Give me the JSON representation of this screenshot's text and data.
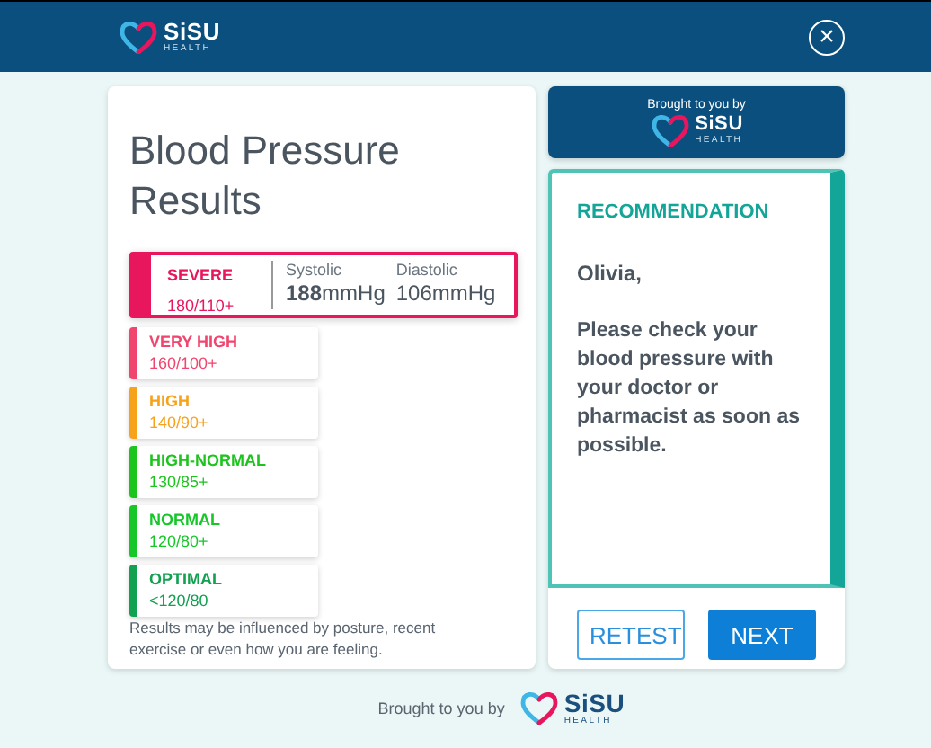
{
  "header": {
    "logo": {
      "name": "SiSU",
      "tagline": "HEALTH"
    },
    "close_label": "×"
  },
  "results": {
    "title": "Blood Pressure Results",
    "categories": [
      {
        "label": "SEVERE",
        "range": "180/110+",
        "color": "#e8175d",
        "selected": true
      },
      {
        "label": "VERY HIGH",
        "range": "160/100+",
        "color": "#f0456e",
        "selected": false
      },
      {
        "label": "HIGH",
        "range": "140/90+",
        "color": "#f7a21b",
        "selected": false
      },
      {
        "label": "HIGH-NORMAL",
        "range": "130/85+",
        "color": "#1ec41e",
        "selected": false
      },
      {
        "label": "NORMAL",
        "range": "120/80+",
        "color": "#17c72a",
        "selected": false
      },
      {
        "label": "OPTIMAL",
        "range": "<120/80",
        "color": "#12a150",
        "selected": false
      }
    ],
    "reading": [
      {
        "label": "Systolic",
        "value": "**188**mmHg"
      },
      {
        "label": "Diastolic",
        "value": "106mmHg"
      }
    ],
    "note": "Results may be influenced by posture, recent exercise or even how you are feeling."
  },
  "sponsor": {
    "caption": "Brought to you by",
    "logo": {
      "name": "SiSU",
      "tagline": "HEALTH"
    }
  },
  "recommendation": {
    "heading": "RECOMMENDATION",
    "greeting": "Olivia,",
    "message": "Please check your blood pressure with your doctor or pharmacist as soon as possible."
  },
  "buttons": [
    {
      "label": "RETEST",
      "kind": "outline"
    },
    {
      "label": "NEXT",
      "kind": "primary"
    }
  ],
  "footer": {
    "caption": "Brought to you by",
    "logo": {
      "name": "SiSU",
      "tagline": "HEALTH"
    }
  }
}
